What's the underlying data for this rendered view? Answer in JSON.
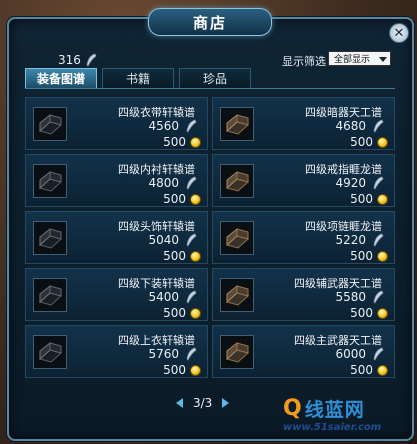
{
  "window": {
    "title": "商店"
  },
  "close_icon": "close-icon",
  "currency": {
    "amount": "316",
    "icon": "feather-icon"
  },
  "filter": {
    "label": "显示筛选",
    "selected": "全部显示"
  },
  "tabs": [
    {
      "label": "装备图谱",
      "active": true
    },
    {
      "label": "书籍",
      "active": false
    },
    {
      "label": "珍品",
      "active": false
    }
  ],
  "items": [
    {
      "name": "四级衣带轩辕谱",
      "price": "4560",
      "gold": "500"
    },
    {
      "name": "四级暗器天工谱",
      "price": "4680",
      "gold": "500"
    },
    {
      "name": "四级内衬轩辕谱",
      "price": "4800",
      "gold": "500"
    },
    {
      "name": "四级戒指睚龙谱",
      "price": "4920",
      "gold": "500"
    },
    {
      "name": "四级头饰轩辕谱",
      "price": "5040",
      "gold": "500"
    },
    {
      "name": "四级项链睚龙谱",
      "price": "5220",
      "gold": "500"
    },
    {
      "name": "四级下装轩辕谱",
      "price": "5400",
      "gold": "500"
    },
    {
      "name": "四级辅武器天工谱",
      "price": "5580",
      "gold": "500"
    },
    {
      "name": "四级上衣轩辕谱",
      "price": "5760",
      "gold": "500"
    },
    {
      "name": "四级主武器天工谱",
      "price": "6000",
      "gold": "500"
    }
  ],
  "pager": {
    "text": "3/3"
  },
  "watermark": {
    "logo_main": "Q",
    "logo_text": "线蓝网",
    "url": "www.51saier.com"
  },
  "colors": {
    "accent": "#5cb8e6",
    "frame_border": "#5b87a0",
    "coin": "#f3c424"
  }
}
